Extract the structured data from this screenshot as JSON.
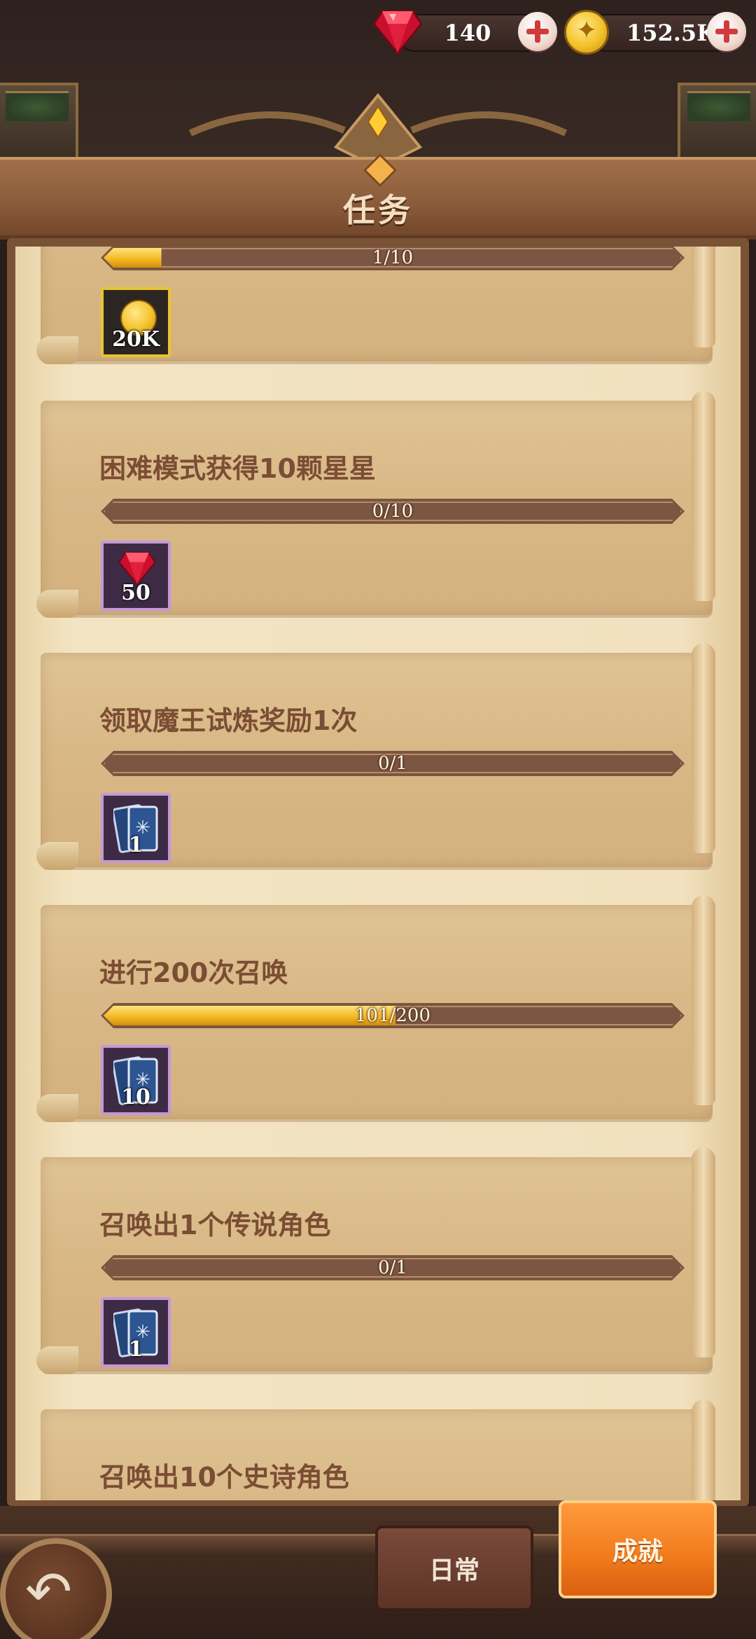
{
  "currency": {
    "gems": "140",
    "gold": "152.5K",
    "gem_icon": "ruby-gem-icon",
    "gold_icon": "gold-coin-icon"
  },
  "header": {
    "title": "任务"
  },
  "tasks": [
    {
      "title": "",
      "progress_text": "1/10",
      "progress": 0.1,
      "reward_icon": "gold-coin-icon",
      "reward_amount": "20K"
    },
    {
      "title": "困难模式获得10颗星星",
      "progress_text": "0/10",
      "progress": 0,
      "reward_icon": "ruby-gem-icon",
      "reward_amount": "50"
    },
    {
      "title": "领取魔王试炼奖励1次",
      "progress_text": "0/1",
      "progress": 0,
      "reward_icon": "summon-card-icon",
      "reward_amount": "1"
    },
    {
      "title": "进行200次召唤",
      "progress_text": "101/200",
      "progress": 0.505,
      "reward_icon": "summon-card-icon",
      "reward_amount": "10"
    },
    {
      "title": "召唤出1个传说角色",
      "progress_text": "0/1",
      "progress": 0,
      "reward_icon": "summon-card-icon",
      "reward_amount": "1"
    },
    {
      "title": "召唤出10个史诗角色"
    }
  ],
  "nav": {
    "back_icon": "back-arrow-icon",
    "tab_daily": "日常",
    "tab_achievement": "成就",
    "active_tab": "成就"
  },
  "colors": {
    "accent_orange": "#f07a1c",
    "progress_gold": "#f2b51f",
    "title_brown": "#7b4d34"
  }
}
